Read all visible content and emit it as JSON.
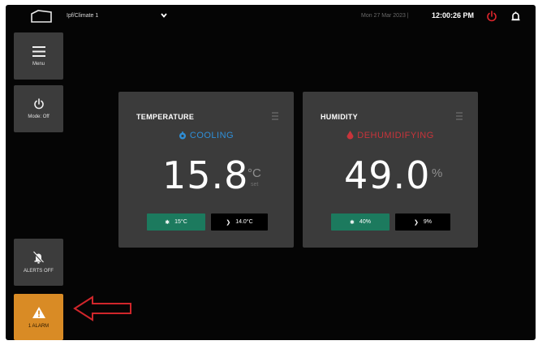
{
  "header": {
    "device_name": "Ipf/Climate 1",
    "datetime": "Mon 27 Mar 2023 | ",
    "time": "12:00:26 PM"
  },
  "sidebar": {
    "menu_label": "Menu",
    "mode_label": "Mode: Off",
    "alerts_label": "ALERTS OFF",
    "alarm_label": "1 ALARM"
  },
  "temperature": {
    "title": "TEMPERATURE",
    "status": "COOLING",
    "value": "15.8",
    "unit": "°C",
    "unit_sub": "set",
    "setpoint": "15°C",
    "actual": "14.0°C"
  },
  "humidity": {
    "title": "HUMIDITY",
    "status": "DEHUMIDIFYING",
    "value": "49.0",
    "unit": "%",
    "setpoint": "40%",
    "actual": "9%"
  },
  "colors": {
    "cooling": "#2f8fd8",
    "dehumidifying": "#c8343b",
    "setpoint_green": "#1c7a5e",
    "alarm": "#d98b25",
    "annotation_arrow": "#d0262b"
  },
  "icons": {
    "logo": "home-outline-icon",
    "chevron": "chevron-down-icon",
    "power": "power-icon",
    "bell": "bell-icon",
    "menu": "hamburger-menu-icon",
    "mode": "power-icon",
    "alerts": "bell-off-icon",
    "alarm": "warning-triangle-icon"
  }
}
